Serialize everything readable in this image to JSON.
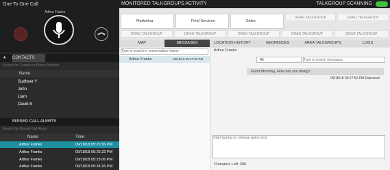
{
  "call": {
    "title": "One To One Call",
    "name": "Arthur Franks"
  },
  "contacts": {
    "tab_label": "CONTACTS",
    "search_placeholder": "Search for Contact or Phone Number",
    "header": "Name",
    "items": [
      {
        "name": "Sudheer Y"
      },
      {
        "name": "John"
      },
      {
        "name": "Liam"
      },
      {
        "name": "David B"
      }
    ]
  },
  "missed": {
    "tab_label": "MISSED CALL ALERTS",
    "search_placeholder": "Search for Missed Call Alerts",
    "col_name": "Name",
    "col_time": "Time",
    "items": [
      {
        "name": "Arthur Franks",
        "time": "09/18/18 05:25:56 PM"
      },
      {
        "name": "Arthur Franks",
        "time": "09/18/18 05:25:22 PM"
      },
      {
        "name": "Arthur Franks",
        "time": "09/18/18 05:25:06 PM"
      },
      {
        "name": "Arthur Franks",
        "time": "09/18/18 05:24:16 PM"
      }
    ]
  },
  "talkgroups": {
    "title": "MONITORED TALKGROUPS ACTIVITY",
    "scanning_label": "TALKGROUP SCANNING",
    "groups": [
      {
        "name": "Marketing"
      },
      {
        "name": "Field Services"
      },
      {
        "name": "Sales"
      }
    ],
    "drag_label": "DRAG TALKGROUP"
  },
  "nav": [
    "MAP",
    "MESSAGES",
    "LOCATION HISTORY",
    "GEOFENCES",
    "AREA TALKGROUPS",
    "LOGS"
  ],
  "conversation": {
    "search_placeholder": "Type to search in conversation history",
    "items": [
      {
        "name": "Arthur Franks",
        "time": "09/18/18 05:27:52 PM"
      }
    ]
  },
  "chat": {
    "header": "Arthur Franks",
    "filter": "All",
    "search_placeholder": "Type to search messages",
    "message": "Good Morning, How are you doing?",
    "meta": "09/18/18 05:27:52 PM Delivered",
    "input_placeholder": "Start typing or choose quick text",
    "chars_left": "Charaters Left: 300"
  }
}
